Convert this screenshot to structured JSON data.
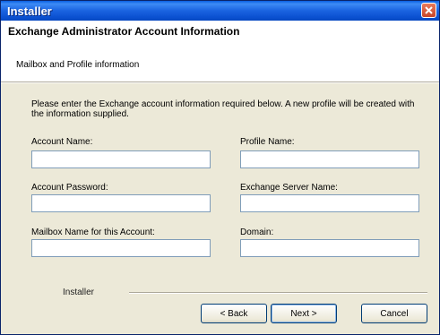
{
  "window": {
    "title": "Installer"
  },
  "header": {
    "title": "Exchange Administrator Account Information",
    "subtitle": "Mailbox and Profile information"
  },
  "description": "Please enter the Exchange account information required below. A new profile will be created with the information supplied.",
  "fields": {
    "account_name": {
      "label": "Account Name:",
      "value": ""
    },
    "profile_name": {
      "label": "Profile Name:",
      "value": ""
    },
    "account_password": {
      "label": "Account Password:",
      "value": ""
    },
    "exchange_server_name": {
      "label": "Exchange Server Name:",
      "value": ""
    },
    "mailbox_name": {
      "label": "Mailbox Name for this Account:",
      "value": ""
    },
    "domain": {
      "label": "Domain:",
      "value": ""
    }
  },
  "footer": {
    "label": "Installer"
  },
  "buttons": {
    "back": "< Back",
    "next": "Next >",
    "cancel": "Cancel"
  },
  "colors": {
    "title_bar": "#0a5fe1",
    "dialog_bg": "#ece9d8",
    "close_button": "#c7452a"
  }
}
